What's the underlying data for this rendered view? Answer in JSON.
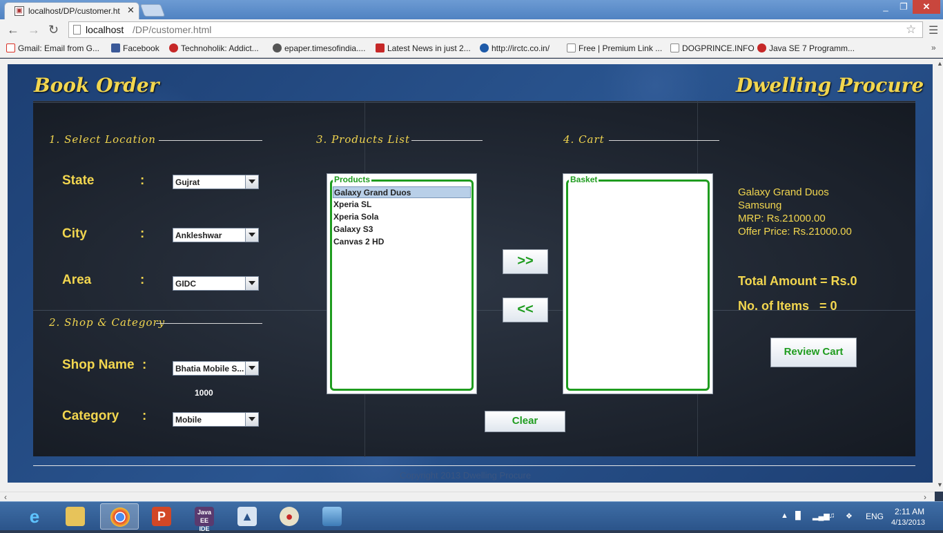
{
  "browser": {
    "tab_title": "localhost/DP/customer.ht",
    "url_host": "localhost",
    "url_path": "/DP/customer.html",
    "bookmarks": [
      {
        "label": "Gmail: Email from G...",
        "color": "#d93025"
      },
      {
        "label": "Facebook",
        "color": "#3b5998"
      },
      {
        "label": "Technoholik: Addict...",
        "color": "#c62828"
      },
      {
        "label": "epaper.timesofindia....",
        "color": "#555555"
      },
      {
        "label": "Latest News in just 2...",
        "color": "#c62828"
      },
      {
        "label": "http://irctc.co.in/",
        "color": "#1e5aa8"
      },
      {
        "label": "Free | Premium Link ...",
        "color": "#ffffff"
      },
      {
        "label": "DOGPRINCE.INFO",
        "color": "#ffffff"
      },
      {
        "label": "Java SE 7 Programm...",
        "color": "#c62828"
      }
    ]
  },
  "app": {
    "title_left": "Book Order",
    "title_right": "Dwelling Procure",
    "sections": {
      "location": "1. Select Location",
      "products": "3. Products List",
      "cart": "4. Cart",
      "shop": "2. Shop & Category"
    },
    "fields": {
      "state": {
        "label": "State",
        "value": "Gujrat"
      },
      "city": {
        "label": "City",
        "value": "Ankleshwar"
      },
      "area": {
        "label": "Area",
        "value": "GIDC"
      },
      "shop": {
        "label": "Shop Name",
        "value": "Bhatia Mobile S...",
        "id": "1000"
      },
      "category": {
        "label": "Category",
        "value": "Mobile"
      }
    },
    "colon": ":",
    "products_legend": "Products",
    "products": [
      "Galaxy Grand Duos",
      "Xperia SL",
      "Xperia Sola",
      "Galaxy S3",
      "Canvas 2 HD"
    ],
    "selected_product_index": 0,
    "basket_legend": "Basket",
    "basket": [],
    "add_button": ">>",
    "remove_button": "<<",
    "clear_button": "Clear",
    "review_button": "Review Cart",
    "details": {
      "name": "Galaxy Grand Duos",
      "brand": "Samsung",
      "mrp": "MRP: Rs.21000.00",
      "offer": "Offer Price: Rs.21000.00"
    },
    "total_amount": "Total Amount = Rs.0",
    "num_items": "No. of Items   = 0",
    "copyright": "Copyright 2013  Dwelling Procure"
  },
  "taskbar": {
    "apps": [
      "Internet Explorer",
      "File Explorer",
      "Chrome",
      "PowerPoint",
      "Java EE IDE",
      "NetBeans",
      "Paint",
      "Photo Viewer"
    ],
    "language": "ENG",
    "time": "2:11 AM",
    "date": "4/13/2013"
  },
  "colors": {
    "accent_yellow": "#f2d64f",
    "accent_green": "#1f9c1f",
    "close_red": "#c9463d"
  }
}
